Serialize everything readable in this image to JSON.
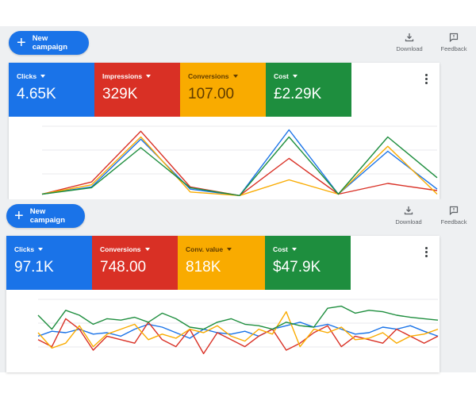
{
  "panels": [
    {
      "new_campaign_label": "New campaign",
      "download_label": "Download",
      "feedback_label": "Feedback",
      "metrics": [
        {
          "name": "Clicks",
          "value": "4.65K",
          "color": "#1a73e8"
        },
        {
          "name": "Impressions",
          "value": "329K",
          "color": "#d93025"
        },
        {
          "name": "Conversions",
          "value": "107.00",
          "color": "#f9ab00"
        },
        {
          "name": "Cost",
          "value": "£2.29K",
          "color": "#1e8e3e"
        }
      ]
    },
    {
      "new_campaign_label": "New campaign",
      "download_label": "Download",
      "feedback_label": "Feedback",
      "metrics": [
        {
          "name": "Clicks",
          "value": "97.1K",
          "color": "#1a73e8"
        },
        {
          "name": "Conversions",
          "value": "748.00",
          "color": "#d93025"
        },
        {
          "name": "Conv. value",
          "value": "818K",
          "color": "#f9ab00"
        },
        {
          "name": "Cost",
          "value": "$47.9K",
          "color": "#1e8e3e"
        }
      ]
    }
  ],
  "chart_data": [
    {
      "type": "line",
      "ylim": [
        0,
        100
      ],
      "grid": true,
      "series": [
        {
          "color": "#1a73e8",
          "values": [
            5,
            15,
            82,
            12,
            3,
            95,
            5,
            65,
            12
          ]
        },
        {
          "color": "#d93025",
          "values": [
            5,
            22,
            93,
            15,
            3,
            55,
            5,
            20,
            10
          ]
        },
        {
          "color": "#f9ab00",
          "values": [
            5,
            18,
            85,
            8,
            3,
            25,
            5,
            72,
            5
          ]
        },
        {
          "color": "#1e8e3e",
          "values": [
            5,
            14,
            70,
            14,
            3,
            85,
            5,
            85,
            28
          ]
        }
      ]
    },
    {
      "type": "line",
      "ylim": [
        0,
        100
      ],
      "grid": true,
      "series": [
        {
          "color": "#1a73e8",
          "values": [
            45,
            52,
            50,
            55,
            48,
            50,
            45,
            55,
            62,
            58,
            50,
            42,
            55,
            50,
            48,
            52,
            45,
            55,
            60,
            65,
            58,
            62,
            55,
            48,
            50,
            58,
            55,
            60,
            52,
            45
          ]
        },
        {
          "color": "#d93025",
          "values": [
            40,
            30,
            70,
            55,
            25,
            45,
            40,
            35,
            65,
            40,
            30,
            55,
            20,
            50,
            40,
            30,
            45,
            55,
            25,
            35,
            50,
            60,
            30,
            45,
            40,
            35,
            55,
            45,
            35,
            45
          ]
        },
        {
          "color": "#f9ab00",
          "values": [
            50,
            28,
            35,
            60,
            30,
            48,
            55,
            62,
            40,
            48,
            42,
            55,
            50,
            60,
            45,
            38,
            55,
            48,
            80,
            30,
            55,
            50,
            58,
            40,
            42,
            50,
            35,
            45,
            48,
            55
          ]
        },
        {
          "color": "#1e8e3e",
          "values": [
            75,
            55,
            82,
            75,
            62,
            70,
            68,
            72,
            65,
            78,
            70,
            58,
            55,
            65,
            70,
            62,
            60,
            55,
            65,
            60,
            58,
            85,
            88,
            78,
            82,
            80,
            75,
            72,
            70,
            68
          ]
        }
      ]
    }
  ]
}
